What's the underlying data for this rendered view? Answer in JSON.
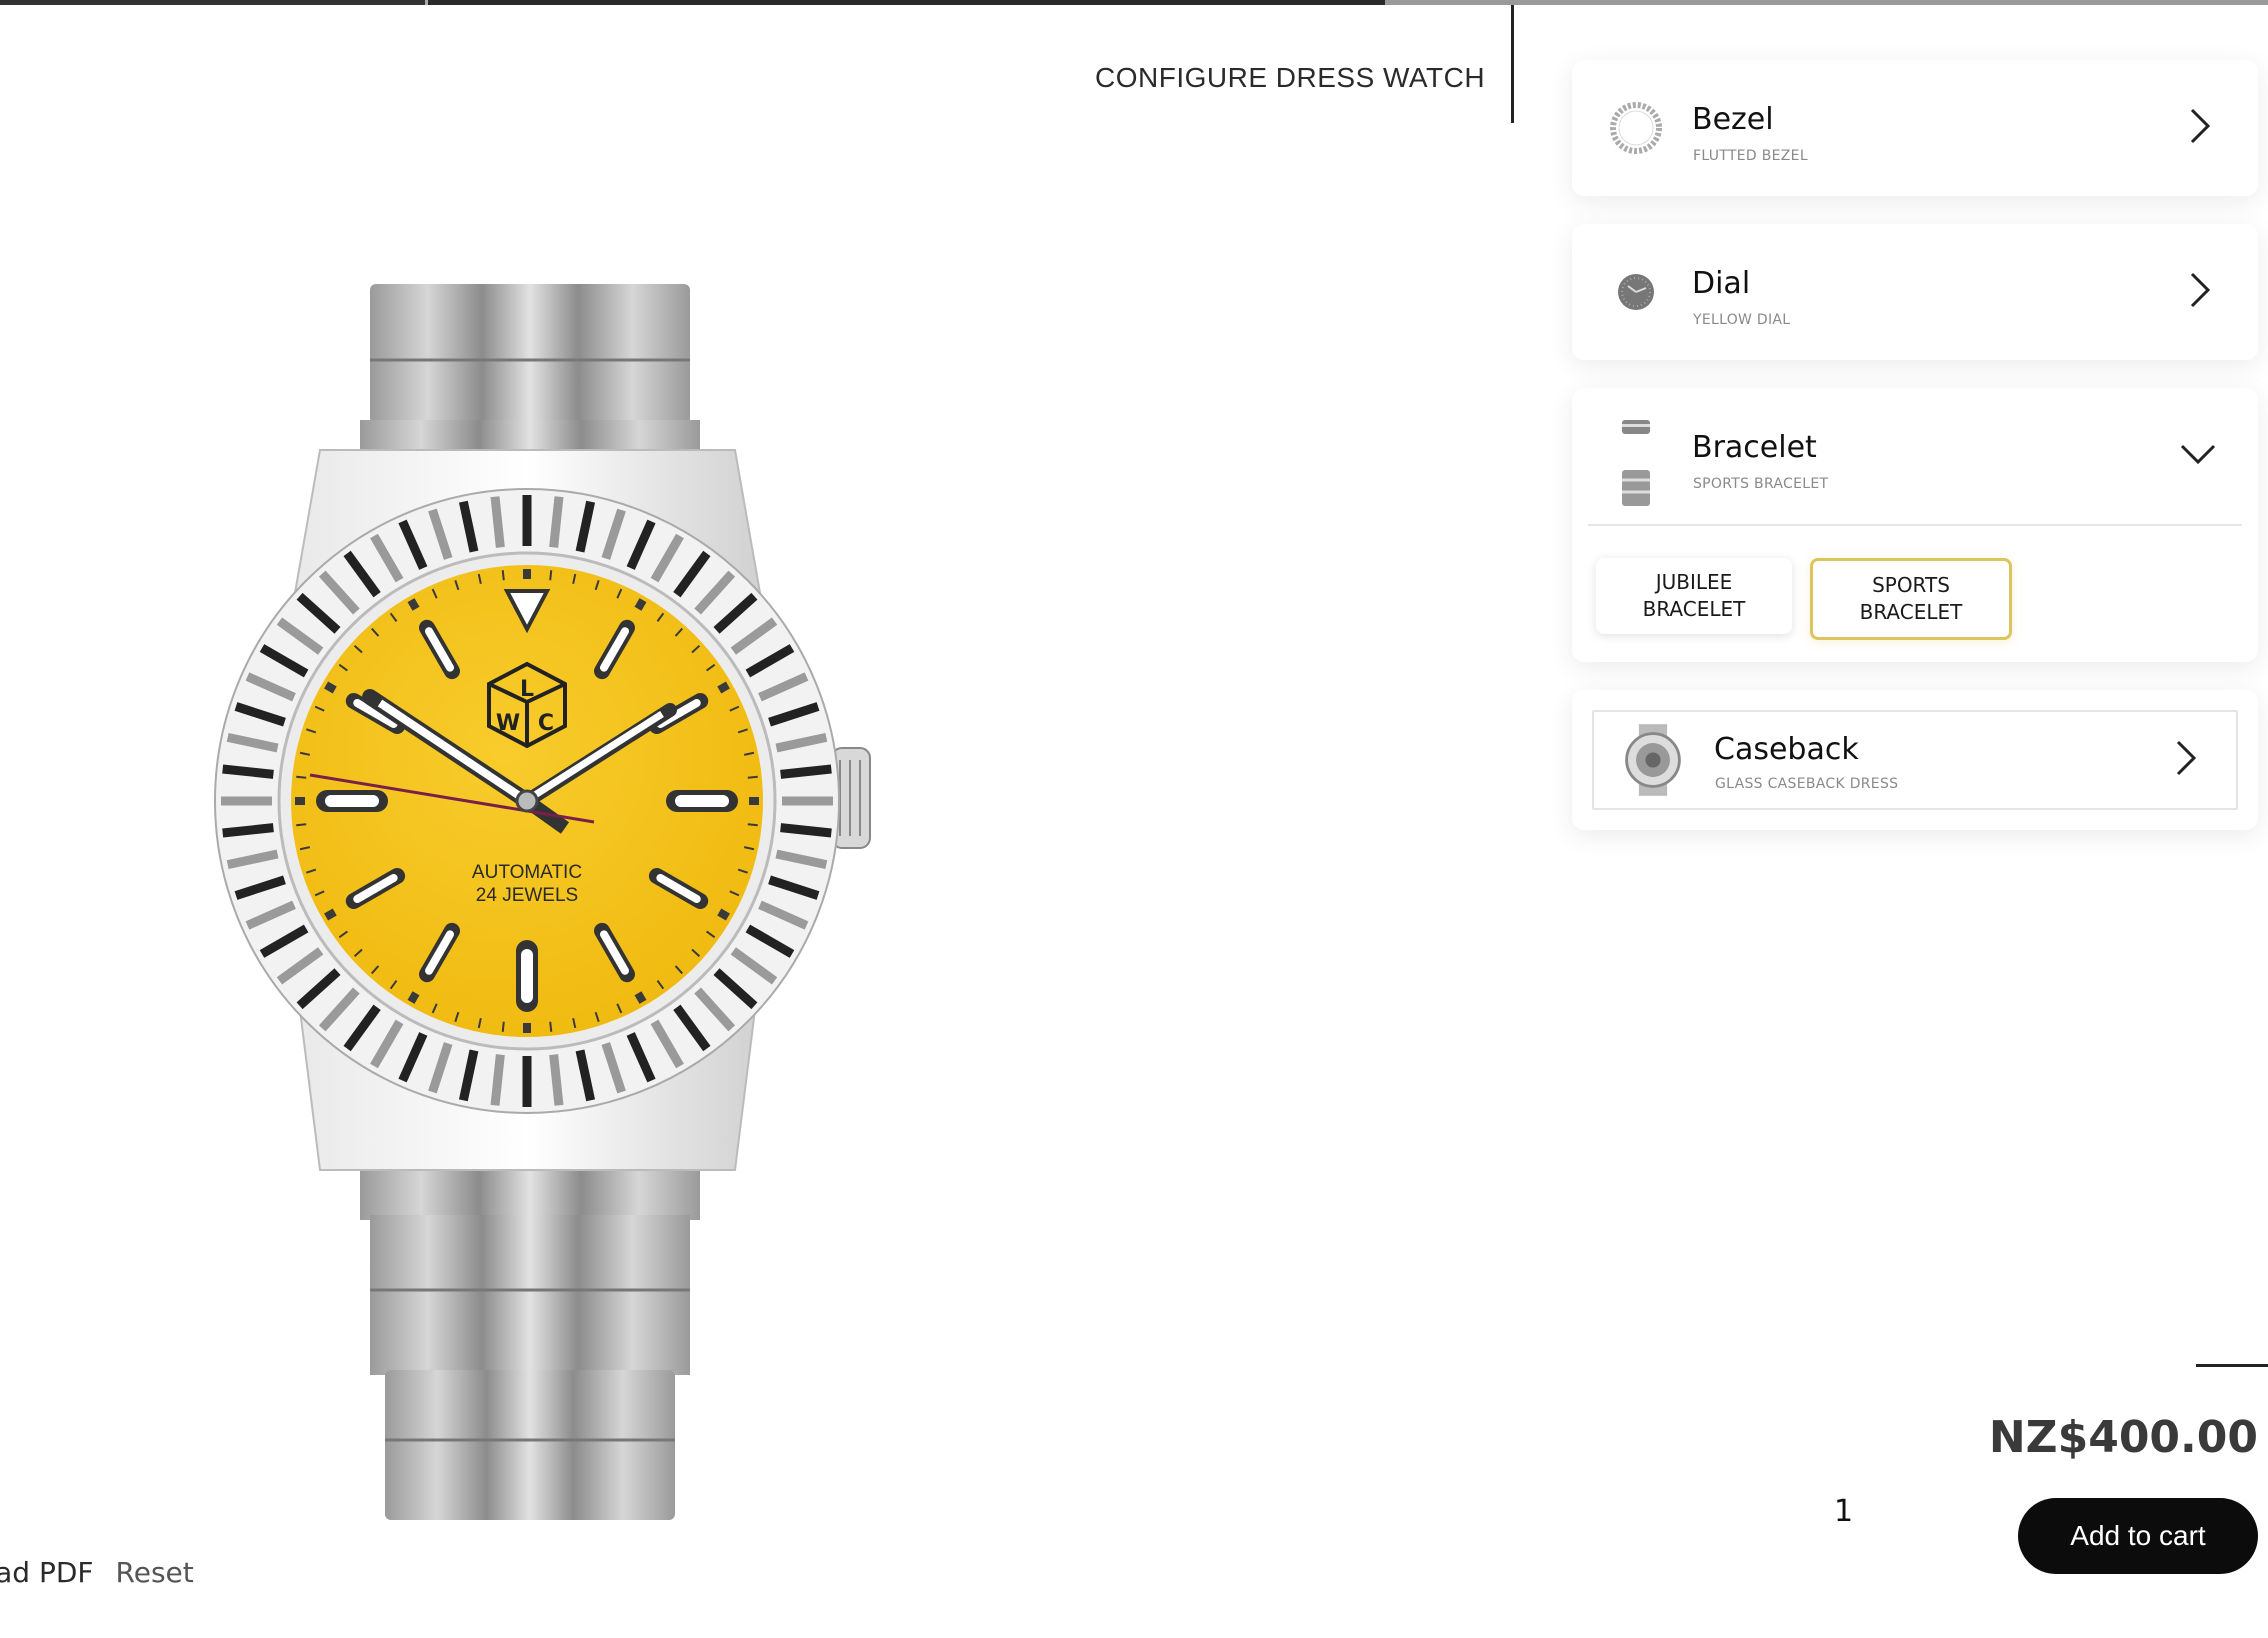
{
  "header": {
    "title": "CONFIGURE DRESS WATCH"
  },
  "watch": {
    "brand_letters": [
      "L",
      "W",
      "C"
    ],
    "dial_line1": "AUTOMATIC",
    "dial_line2": "24 JEWELS",
    "dial_color": "#f5c11a"
  },
  "options": {
    "bezel": {
      "name": "Bezel",
      "selected": "FLUTTED BEZEL"
    },
    "dial": {
      "name": "Dial",
      "selected": "YELLOW DIAL"
    },
    "bracelet": {
      "name": "Bracelet",
      "selected": "SPORTS BRACELET",
      "choices": [
        {
          "line1": "JUBILEE",
          "line2": "BRACELET"
        },
        {
          "line1": "SPORTS",
          "line2": "BRACELET"
        }
      ]
    },
    "caseback": {
      "name": "Caseback",
      "selected": "GLASS CASEBACK DRESS"
    }
  },
  "purchase": {
    "price": "NZ$400.00",
    "quantity": "1",
    "add_to_cart": "Add to cart"
  },
  "links": {
    "pdf": "oad PDF",
    "reset": "Reset"
  },
  "colors": {
    "accent": "#dcc55a",
    "button": "#0c0c0c"
  }
}
